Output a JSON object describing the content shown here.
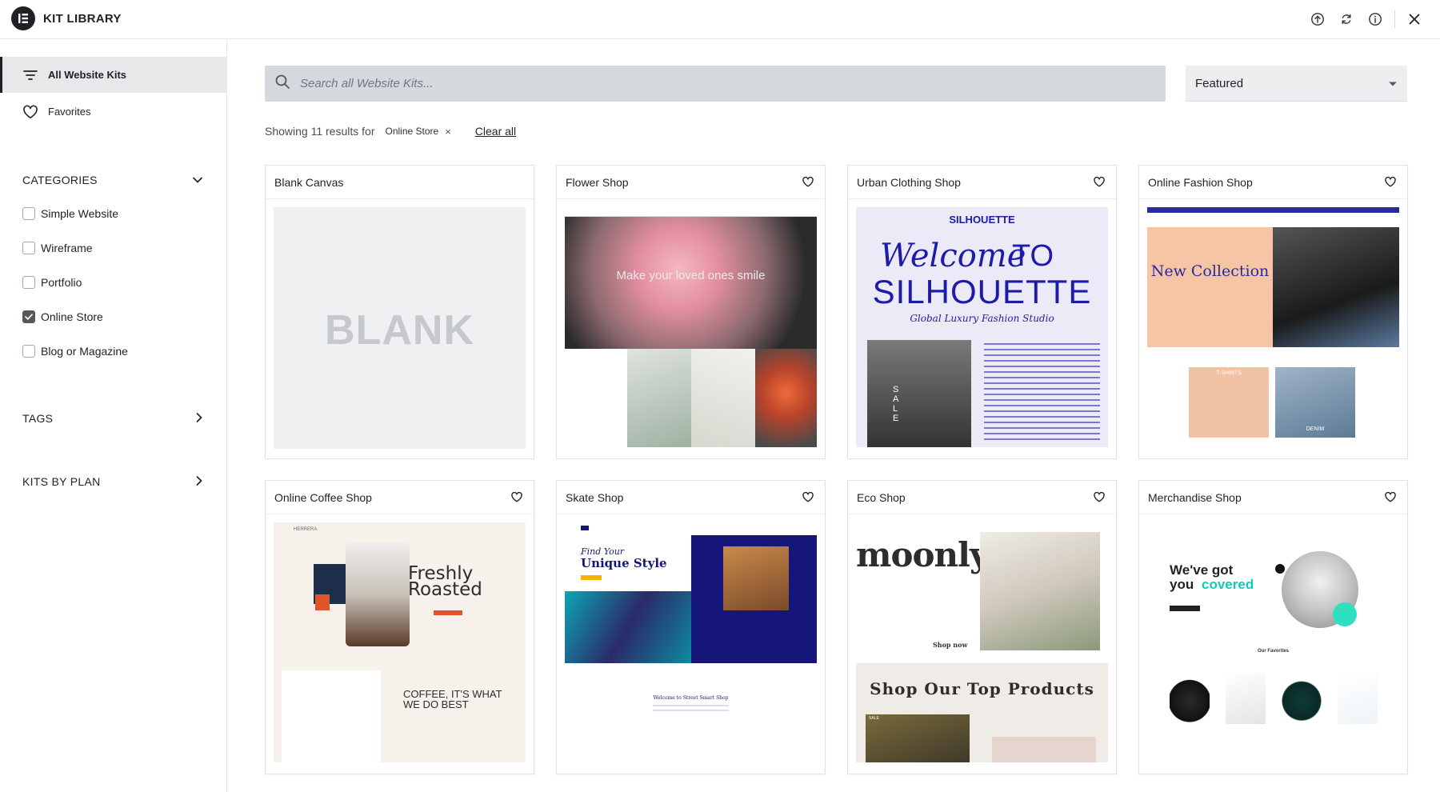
{
  "app": {
    "title": "KIT LIBRARY"
  },
  "header_icons": [
    {
      "name": "upload-icon"
    },
    {
      "name": "sync-icon"
    },
    {
      "name": "info-icon"
    },
    {
      "name": "close-icon"
    }
  ],
  "sidebar": {
    "nav": [
      {
        "label": "All Website Kits",
        "icon": "filter-lines-icon",
        "active": true
      },
      {
        "label": "Favorites",
        "icon": "heart-icon",
        "active": false
      }
    ],
    "categories": {
      "header": "CATEGORIES",
      "items": [
        {
          "label": "Simple Website",
          "checked": false
        },
        {
          "label": "Wireframe",
          "checked": false
        },
        {
          "label": "Portfolio",
          "checked": false
        },
        {
          "label": "Online Store",
          "checked": true
        },
        {
          "label": "Blog or Magazine",
          "checked": false
        }
      ]
    },
    "tags_header": "TAGS",
    "plan_header": "KITS BY PLAN"
  },
  "search": {
    "placeholder": "Search all Website Kits..."
  },
  "sort": {
    "selected": "Featured"
  },
  "results": {
    "text": "Showing 11 results for",
    "filter_chip": "Online Store",
    "chip_remove": "×",
    "clear_label": "Clear all"
  },
  "cards": [
    {
      "title": "Blank Canvas",
      "favorite": false,
      "preview": {
        "big": "BLANK"
      }
    },
    {
      "title": "Flower Shop",
      "favorite": true,
      "preview": {
        "hero": "Make your loved ones smile"
      }
    },
    {
      "title": "Urban Clothing Shop",
      "favorite": true,
      "preview": {
        "brand": "SILHOUETTE",
        "welcome": "Welcome",
        "to": "TO",
        "big": "SILHOUETTE",
        "tag": "Global Luxury Fashion Studio",
        "sale": "SALE"
      }
    },
    {
      "title": "Online Fashion Shop",
      "favorite": true,
      "preview": {
        "hero": "New Collection",
        "tshirts": "T-SHIRTS",
        "denim": "DENIM"
      }
    },
    {
      "title": "Online Coffee Shop",
      "favorite": true,
      "preview": {
        "brand": "HERRERA",
        "hero": "Freshly Roasted",
        "sub": "COFFEE, IT'S WHAT WE DO BEST"
      }
    },
    {
      "title": "Skate Shop",
      "favorite": true,
      "preview": {
        "hero_top": "Find Your",
        "hero": "Unique Style",
        "welcome": "Welcome to Street Smart Shop"
      }
    },
    {
      "title": "Eco Shop",
      "favorite": true,
      "preview": {
        "brand": "moonly",
        "shop_now": "Shop now",
        "products": "Shop Our Top Products",
        "sale": "SALE"
      }
    },
    {
      "title": "Merchandise Shop",
      "favorite": true,
      "preview": {
        "hero_a": "We've got",
        "hero_b": "you",
        "hero_c": "covered",
        "favs": "Our Favorites"
      }
    }
  ],
  "colors": {
    "accent": "#1f2124",
    "search_bg": "#d5d8dc",
    "sidebar_active": "#e6e8ea"
  }
}
